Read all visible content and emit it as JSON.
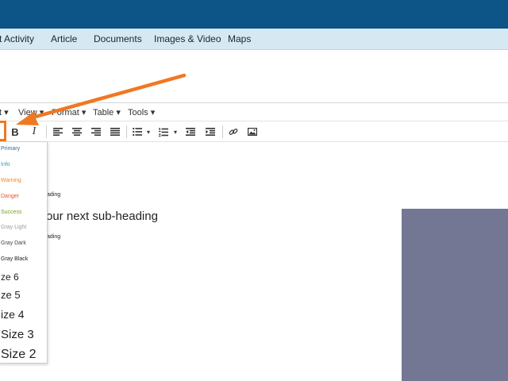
{
  "nav": {
    "items": [
      "t Activity",
      "Article",
      "Documents",
      "Images & Video",
      "Maps"
    ]
  },
  "menubar": {
    "items": [
      "t ▾",
      "View ▾",
      "Format ▾",
      "Table ▾",
      "Tools ▾"
    ]
  },
  "toolbar": {
    "bold_label": "B",
    "italic_label": "I",
    "caret": "▾"
  },
  "dropdown": {
    "items": [
      {
        "label": "Primary",
        "color": "#2d6ca8"
      },
      {
        "label": "Info",
        "color": "#3d95c8"
      },
      {
        "label": "Warning",
        "color": "#f08a24"
      },
      {
        "label": "Danger",
        "color": "#e8532c"
      },
      {
        "label": "Success",
        "color": "#7a9e27"
      },
      {
        "label": "Gray Light",
        "color": "#9a9a9a"
      },
      {
        "label": "Gray Dark",
        "color": "#444444"
      },
      {
        "label": "Gray Black",
        "color": "#222222"
      },
      {
        "label": "ze 6",
        "color": "#222222"
      },
      {
        "label": "ze 5",
        "color": "#222222"
      },
      {
        "label": "ize 4",
        "color": "#222222"
      },
      {
        "label": "Size 3",
        "color": "#222222"
      },
      {
        "label": "Size 2",
        "color": "#222222"
      }
    ]
  },
  "content": {
    "heading_small_1": "ading",
    "subheading": "our next sub-heading",
    "heading_small_2": "ading"
  },
  "colors": {
    "topbar": "#0d5487",
    "navbar": "#d6e9f3",
    "accent_arrow": "#f07822",
    "image_placeholder": "#737793"
  }
}
